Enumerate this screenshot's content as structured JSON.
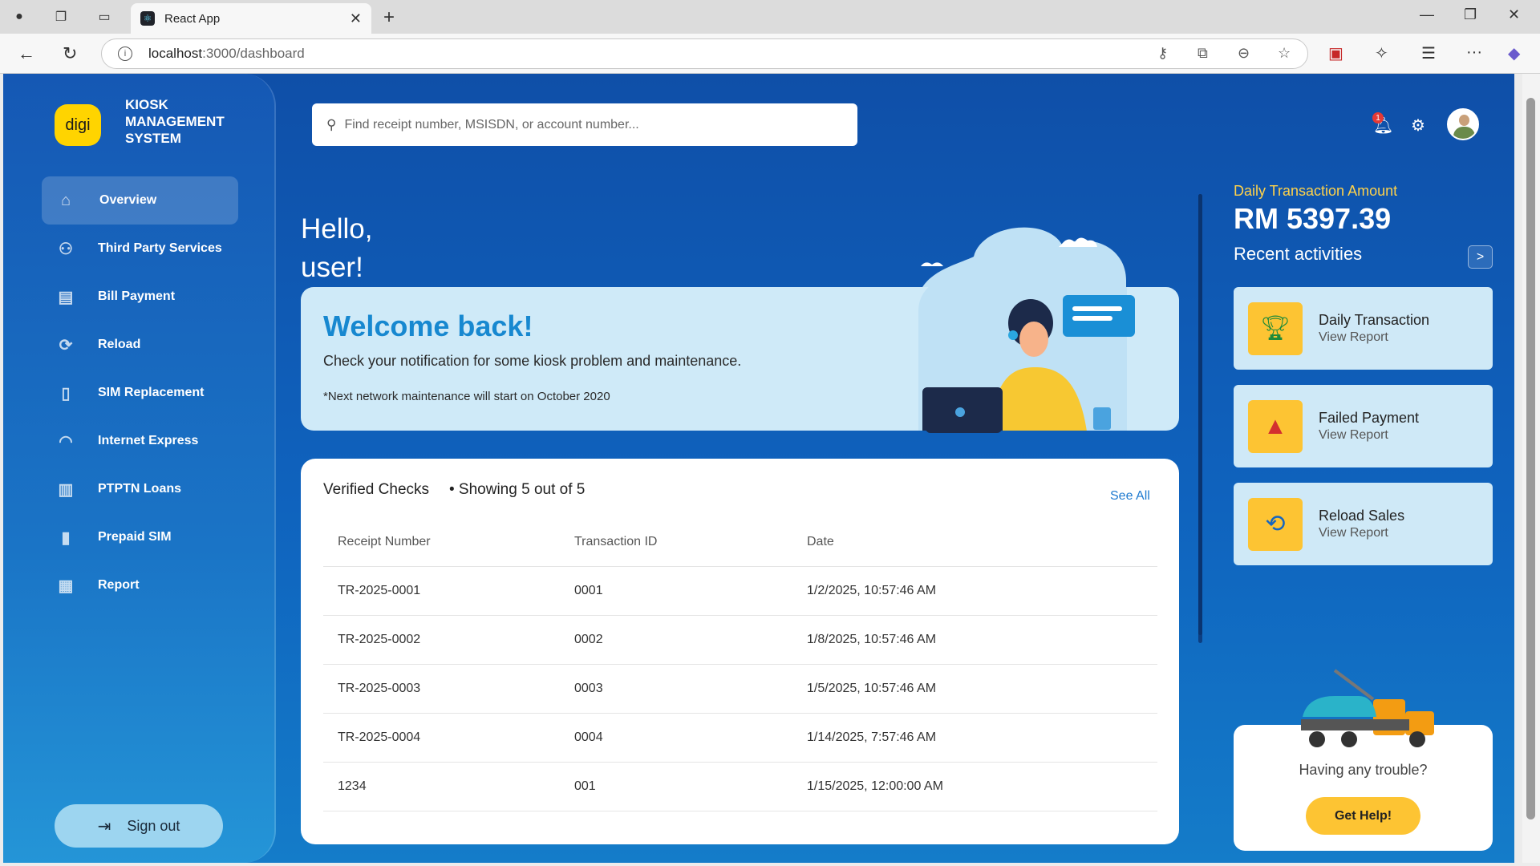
{
  "browser": {
    "tab_title": "React App",
    "url_host": "localhost",
    "url_path": ":3000/dashboard"
  },
  "sidebar": {
    "logo_text": "digi",
    "brand": "KIOSK MANAGEMENT SYSTEM",
    "items": [
      {
        "label": "Overview",
        "icon": "home-icon",
        "active": true
      },
      {
        "label": "Third Party Services",
        "icon": "users-icon"
      },
      {
        "label": "Bill Payment",
        "icon": "bill-icon"
      },
      {
        "label": "Reload",
        "icon": "refresh-icon"
      },
      {
        "label": "SIM Replacement",
        "icon": "phone-icon"
      },
      {
        "label": "Internet Express",
        "icon": "wifi-icon"
      },
      {
        "label": "PTPTN Loans",
        "icon": "book-icon"
      },
      {
        "label": "Prepaid SIM",
        "icon": "mobile-icon"
      },
      {
        "label": "Report",
        "icon": "chart-icon"
      }
    ],
    "signout_label": "Sign out"
  },
  "header": {
    "search_placeholder": "Find receipt number, MSISDN, or account number...",
    "notification_count": "1"
  },
  "main": {
    "hello_line1": "Hello,",
    "hello_line2": "user!",
    "welcome_title": "Welcome back!",
    "welcome_sub": "Check your notification for some kiosk problem and maintenance.",
    "welcome_note": "*Next network maintenance will start on October 2020",
    "checks": {
      "title": "Verified Checks",
      "count": "• Showing 5 out of 5",
      "see_all": "See All",
      "columns": [
        "Receipt Number",
        "Transaction ID",
        "Date"
      ],
      "rows": [
        [
          "TR-2025-0001",
          "0001",
          "1/2/2025, 10:57:46 AM"
        ],
        [
          "TR-2025-0002",
          "0002",
          "1/8/2025, 10:57:46 AM"
        ],
        [
          "TR-2025-0003",
          "0003",
          "1/5/2025, 10:57:46 AM"
        ],
        [
          "TR-2025-0004",
          "0004",
          "1/14/2025, 7:57:46 AM"
        ],
        [
          "1234",
          "001",
          "1/15/2025, 12:00:00 AM"
        ]
      ]
    }
  },
  "right": {
    "daily_label": "Daily Transaction Amount",
    "daily_amount": "RM 5397.39",
    "recent_title": "Recent activities",
    "recent_btn": ">",
    "activities": [
      {
        "title": "Daily Transaction",
        "link": "View Report",
        "icon": "trophy-icon"
      },
      {
        "title": "Failed Payment",
        "link": "View Report",
        "icon": "warning-icon"
      },
      {
        "title": "Reload Sales",
        "link": "View Report",
        "icon": "sync-icon"
      }
    ],
    "help_question": "Having any trouble?",
    "help_button": "Get Help!"
  }
}
